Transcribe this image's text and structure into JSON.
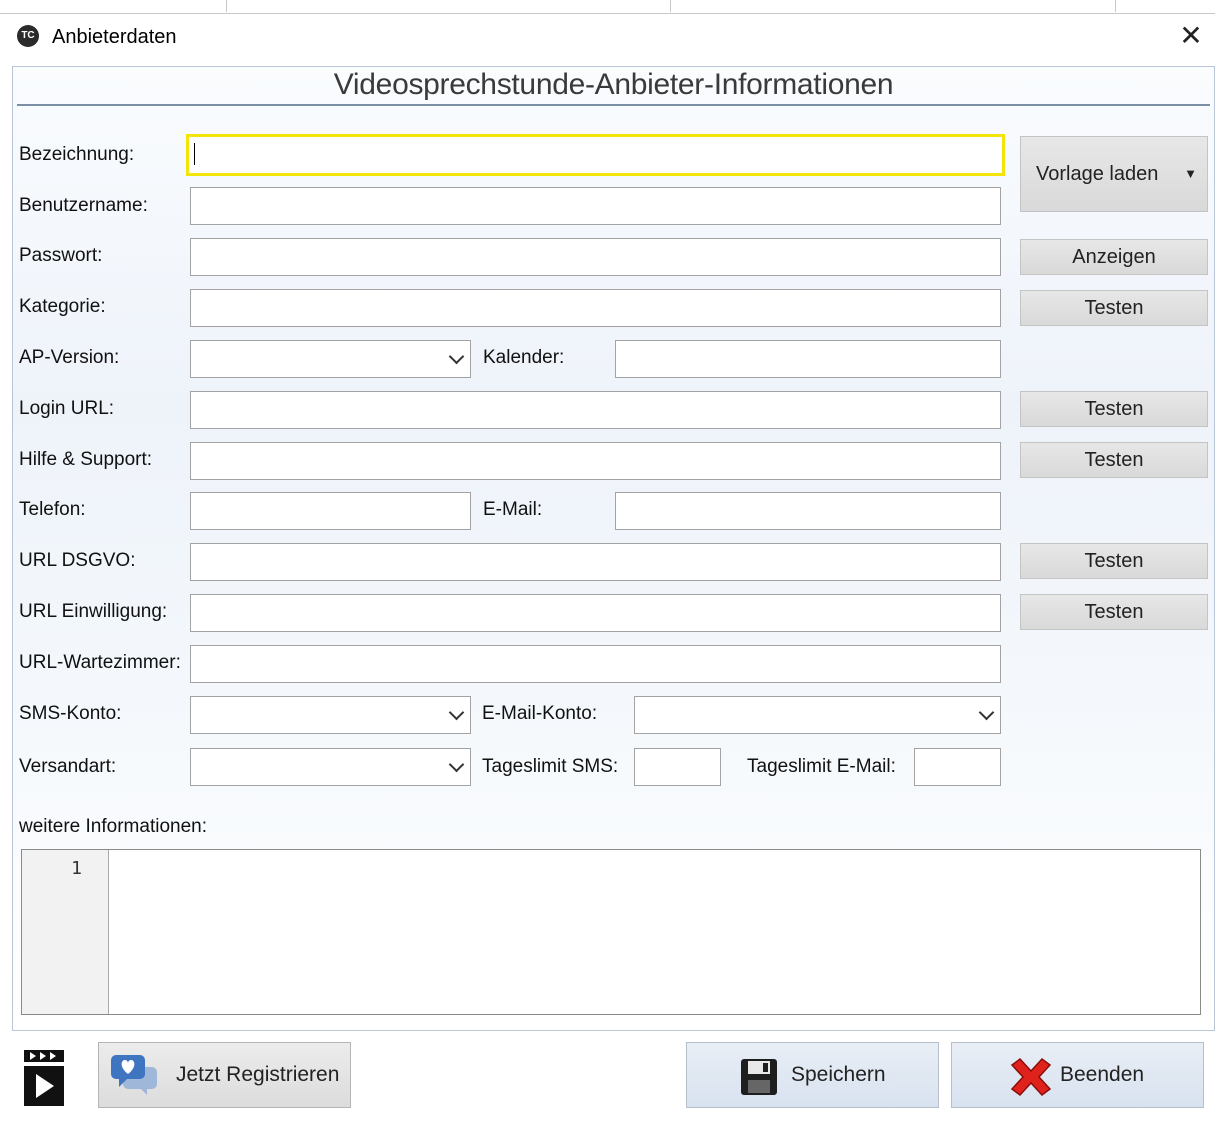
{
  "window": {
    "title": "Anbieterdaten",
    "icon": "app-logo-icon",
    "close_glyph": "✕"
  },
  "form": {
    "heading": "Videosprechstunde-Anbieter-Informationen",
    "labels": {
      "bezeichnung": "Bezeichnung:",
      "benutzername": "Benutzername:",
      "passwort": "Passwort:",
      "kategorie": "Kategorie:",
      "ap_version": "AP-Version:",
      "kalender": "Kalender:",
      "login_url": "Login URL:",
      "hilfe": "Hilfe & Support:",
      "telefon": "Telefon:",
      "email": "E-Mail:",
      "url_dsgvo": "URL DSGVO:",
      "url_einwilligung": "URL Einwilligung:",
      "url_wartezimmer": "URL-Wartezimmer:",
      "sms_konto": "SMS-Konto:",
      "email_konto": "E-Mail-Konto:",
      "versandart": "Versandart:",
      "tageslimit_sms": "Tageslimit SMS:",
      "tageslimit_email": "Tageslimit E-Mail:",
      "weitere": "weitere Informationen:"
    },
    "values": {
      "bezeichnung": "",
      "benutzername": "",
      "passwort": "",
      "kategorie": "",
      "ap_version": "",
      "kalender": "",
      "login_url": "",
      "hilfe": "",
      "telefon": "",
      "email": "",
      "url_dsgvo": "",
      "url_einwilligung": "",
      "url_wartezimmer": "",
      "sms_konto": "",
      "email_konto": "",
      "versandart": "",
      "tageslimit_sms": "",
      "tageslimit_email": "",
      "weitere": ""
    },
    "focused_field": "bezeichnung",
    "focus_color": "#f3e40a"
  },
  "buttons": {
    "vorlage_laden": "Vorlage laden",
    "anzeigen": "Anzeigen",
    "testen": "Testen"
  },
  "memo": {
    "line_numbers": [
      "1"
    ]
  },
  "footer": {
    "clapper_icon": "clapperboard-icon",
    "register_label": "Jetzt Registrieren",
    "register_icon": "chat-heart-icon",
    "save_label": "Speichern",
    "save_icon": "floppy-disk-icon",
    "exit_label": "Beenden",
    "exit_icon": "red-x-icon"
  }
}
